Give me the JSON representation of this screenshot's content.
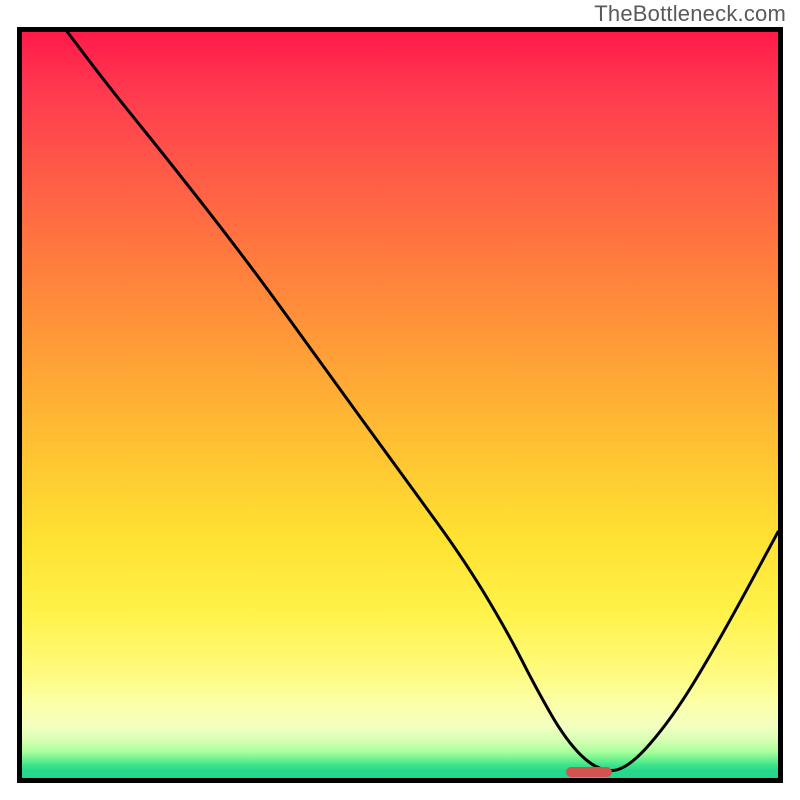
{
  "watermark": "TheBottleneck.com",
  "colors": {
    "frame": "#000000",
    "curve": "#000000",
    "marker": "#d2534f",
    "gradient_top": "#ff1a4a",
    "gradient_mid": "#ffe232",
    "gradient_bottom": "#24d68a"
  },
  "chart_data": {
    "type": "line",
    "title": "",
    "xlabel": "",
    "ylabel": "",
    "xlim": [
      0,
      100
    ],
    "ylim": [
      0,
      100
    ],
    "grid": false,
    "legend": false,
    "series": [
      {
        "name": "bottleneck-curve",
        "x": [
          6,
          12,
          20,
          30,
          40,
          50,
          58,
          64,
          68,
          72,
          76,
          80,
          86,
          92,
          100
        ],
        "y": [
          100,
          92,
          82,
          69,
          55,
          41,
          30,
          20,
          12,
          5,
          1,
          1,
          8,
          18,
          33
        ]
      }
    ],
    "annotations": [
      {
        "name": "min-marker",
        "kind": "pill",
        "x": 75,
        "y": 0.8,
        "width_pct": 6,
        "height_pct": 1.4
      }
    ]
  }
}
